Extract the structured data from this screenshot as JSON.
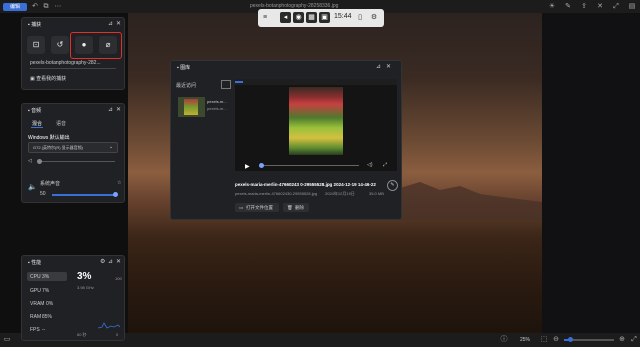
{
  "viewer": {
    "edit_label": "编辑",
    "title": "pexels-botanphotography-28258336.jpg",
    "zoom": "25%",
    "accent": "#3a6fd8"
  },
  "gamebar": {
    "time": "15:44"
  },
  "capture": {
    "title": "捕获",
    "filename": "pexels-botanphotography-282...",
    "view_all": "查看我的捕获"
  },
  "audio": {
    "title": "音频",
    "tab_mix": "混合",
    "tab_voice": "语音",
    "output_label": "Windows 默认输出",
    "device": "G72 (英特尔(R) 显示器音频)",
    "system_sound": "系统声音",
    "volume": "50"
  },
  "gallery": {
    "title": "图库",
    "recent": "最近访问",
    "thumb_label": "pexels-m...",
    "thumb_label2": "pexels-m...",
    "file_title": "pexels-maria-merlin-47660243 0-29555528.jpg 2024-12-19 14-46-22",
    "file_meta": "pexels-maria-merlin-476602430-29555528.jpg",
    "file_date": "2024年12月19日",
    "file_size": "35.0 MB",
    "open_location": "打开文件位置",
    "delete": "删除"
  },
  "perf": {
    "title": "性能",
    "cpu_label": "CPU",
    "cpu_val": "3%",
    "cpu_big": "3%",
    "cpu_freq": "3.98 GHz",
    "cpu_max": "100",
    "gpu_label": "GPU",
    "gpu_val": "7%",
    "vram_label": "VRAM",
    "vram_val": "0%",
    "ram_label": "RAM",
    "ram_val": "85%",
    "fps_label": "FPS",
    "fps_val": "--",
    "fps_range": "60 秒",
    "zero": "0"
  }
}
